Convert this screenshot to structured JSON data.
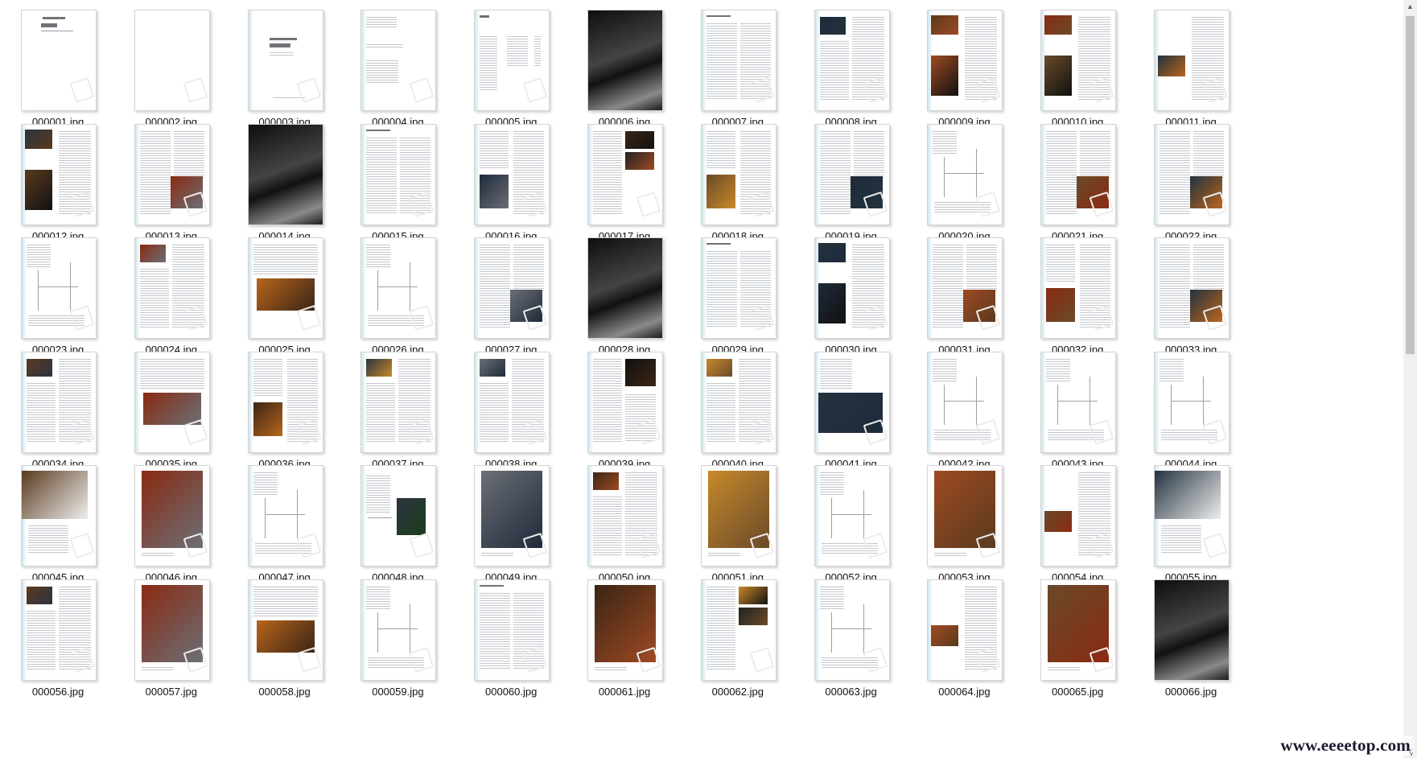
{
  "files": [
    {
      "name": "000001.jpg",
      "kind": "cover"
    },
    {
      "name": "000002.jpg",
      "kind": "blank"
    },
    {
      "name": "000003.jpg",
      "kind": "title"
    },
    {
      "name": "000004.jpg",
      "kind": "colophon"
    },
    {
      "name": "000005.jpg",
      "kind": "contents"
    },
    {
      "name": "000006.jpg",
      "kind": "dark"
    },
    {
      "name": "000007.jpg",
      "kind": "text"
    },
    {
      "name": "000008.jpg",
      "kind": "photo-tl"
    },
    {
      "name": "000009.jpg",
      "kind": "photo-left2"
    },
    {
      "name": "000010.jpg",
      "kind": "photo-left2"
    },
    {
      "name": "000011.jpg",
      "kind": "photo-ml"
    },
    {
      "name": "000012.jpg",
      "kind": "photo-left2"
    },
    {
      "name": "000013.jpg",
      "kind": "photo-br"
    },
    {
      "name": "000014.jpg",
      "kind": "dark"
    },
    {
      "name": "000015.jpg",
      "kind": "text"
    },
    {
      "name": "000016.jpg",
      "kind": "photo-bl"
    },
    {
      "name": "000017.jpg",
      "kind": "photo-right2"
    },
    {
      "name": "000018.jpg",
      "kind": "photo-bl"
    },
    {
      "name": "000019.jpg",
      "kind": "photo-br"
    },
    {
      "name": "000020.jpg",
      "kind": "plan"
    },
    {
      "name": "000021.jpg",
      "kind": "photo-br"
    },
    {
      "name": "000022.jpg",
      "kind": "photo-br"
    },
    {
      "name": "000023.jpg",
      "kind": "plan"
    },
    {
      "name": "000024.jpg",
      "kind": "photo-tl"
    },
    {
      "name": "000025.jpg",
      "kind": "photo-center"
    },
    {
      "name": "000026.jpg",
      "kind": "plan"
    },
    {
      "name": "000027.jpg",
      "kind": "photo-br"
    },
    {
      "name": "000028.jpg",
      "kind": "dark"
    },
    {
      "name": "000029.jpg",
      "kind": "text"
    },
    {
      "name": "000030.jpg",
      "kind": "photo-left2"
    },
    {
      "name": "000031.jpg",
      "kind": "photo-br"
    },
    {
      "name": "000032.jpg",
      "kind": "photo-bl"
    },
    {
      "name": "000033.jpg",
      "kind": "photo-br"
    },
    {
      "name": "000034.jpg",
      "kind": "photo-tl"
    },
    {
      "name": "000035.jpg",
      "kind": "photo-center"
    },
    {
      "name": "000036.jpg",
      "kind": "photo-bl"
    },
    {
      "name": "000037.jpg",
      "kind": "photo-tl"
    },
    {
      "name": "000038.jpg",
      "kind": "photo-tl"
    },
    {
      "name": "000039.jpg",
      "kind": "photo-tr"
    },
    {
      "name": "000040.jpg",
      "kind": "photo-tl"
    },
    {
      "name": "000041.jpg",
      "kind": "photo-bottom"
    },
    {
      "name": "000042.jpg",
      "kind": "plan"
    },
    {
      "name": "000043.jpg",
      "kind": "plan"
    },
    {
      "name": "000044.jpg",
      "kind": "plan"
    },
    {
      "name": "000045.jpg",
      "kind": "photo-top"
    },
    {
      "name": "000046.jpg",
      "kind": "photo-large"
    },
    {
      "name": "000047.jpg",
      "kind": "plan"
    },
    {
      "name": "000048.jpg",
      "kind": "photo-mr"
    },
    {
      "name": "000049.jpg",
      "kind": "photo-large"
    },
    {
      "name": "000050.jpg",
      "kind": "photo-tl"
    },
    {
      "name": "000051.jpg",
      "kind": "photo-large"
    },
    {
      "name": "000052.jpg",
      "kind": "plan"
    },
    {
      "name": "000053.jpg",
      "kind": "photo-large"
    },
    {
      "name": "000054.jpg",
      "kind": "photo-ml"
    },
    {
      "name": "000055.jpg",
      "kind": "photo-top"
    },
    {
      "name": "000056.jpg",
      "kind": "photo-tl"
    },
    {
      "name": "000057.jpg",
      "kind": "photo-large"
    },
    {
      "name": "000058.jpg",
      "kind": "photo-center"
    },
    {
      "name": "000059.jpg",
      "kind": "plan"
    },
    {
      "name": "000060.jpg",
      "kind": "text"
    },
    {
      "name": "000061.jpg",
      "kind": "photo-large"
    },
    {
      "name": "000062.jpg",
      "kind": "photo-right2"
    },
    {
      "name": "000063.jpg",
      "kind": "plan"
    },
    {
      "name": "000064.jpg",
      "kind": "photo-ml"
    },
    {
      "name": "000065.jpg",
      "kind": "photo-large"
    },
    {
      "name": "000066.jpg",
      "kind": "dark"
    }
  ],
  "watermark": {
    "text": "www.eeeetop.com",
    "small": "v"
  },
  "colors": {
    "photo": [
      "#5a3a1e",
      "#8a2a12",
      "#b8651c",
      "#2b3440",
      "#6b6f76",
      "#3a2516",
      "#c7892a",
      "#1f2a3a",
      "#9e4a22",
      "#6a4a2a",
      "#23323f"
    ],
    "dark": "#1a1a1a"
  }
}
